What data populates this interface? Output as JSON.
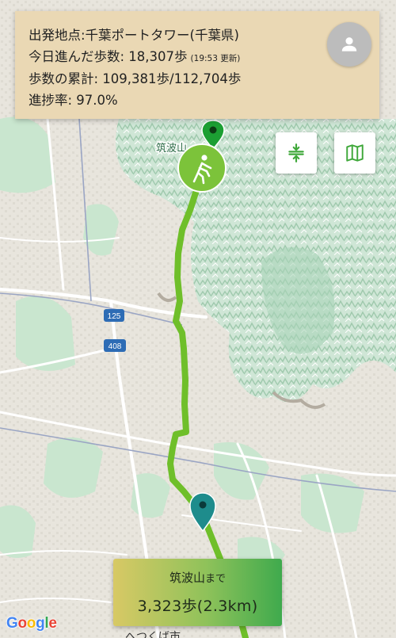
{
  "progress": {
    "origin_line": "出発地点:千葉ポートタワー(千葉県)",
    "today_line": "今日進んだ歩数: 18,307歩",
    "today_updated": "(19:53 更新)",
    "total_line": "歩数の累計: 109,381歩/112,704歩",
    "rate_line": "進捗率: 97.0%",
    "rate_value": 0.97
  },
  "map": {
    "summit_label": "筑波山",
    "route_number_1": "125",
    "route_number_2": "408",
    "bottom_place_label": "へつくば市",
    "attribution": "Google"
  },
  "destination": {
    "name": "筑波山",
    "suffix": "まで",
    "distance": "3,323歩(2.3km)"
  },
  "buttons": {
    "avatar_icon": "person-icon",
    "fit_icon": "vertical-compress-icon",
    "map_icon": "folded-map-icon"
  },
  "colors": {
    "route": "#6fbf2a",
    "walker_marker": "#7cc33a",
    "summit_pin": "#1c9f33",
    "current_pin": "#1e8c8c"
  }
}
